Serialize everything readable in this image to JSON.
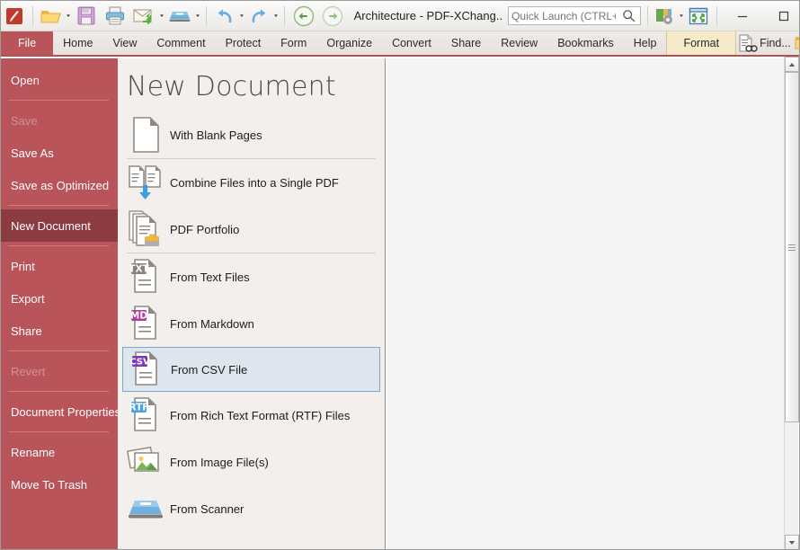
{
  "window": {
    "doc_title": "Architecture - PDF-XChang..",
    "app_icon": "pdf-xchange-logo-icon",
    "minimize_label": "—",
    "maximize_label": "□",
    "close_label": "✕"
  },
  "quick_launch": {
    "placeholder": "Quick Launch (CTRL+.)",
    "value": "",
    "search_icon": "search-icon"
  },
  "toolbar": {
    "items": [
      {
        "name": "open-file-button",
        "icon": "folder-open-icon",
        "has_dropdown": true
      },
      {
        "name": "save-button",
        "icon": "floppy-disk-icon",
        "has_dropdown": false
      },
      {
        "name": "print-button",
        "icon": "printer-icon",
        "has_dropdown": false
      },
      {
        "name": "email-button",
        "icon": "envelope-send-icon",
        "has_dropdown": true
      },
      {
        "name": "scanner-button",
        "icon": "scanner-icon",
        "has_dropdown": true
      },
      {
        "name": "undo-button",
        "icon": "undo-arrow-icon",
        "has_dropdown": true
      },
      {
        "name": "redo-button",
        "icon": "redo-arrow-icon",
        "has_dropdown": true
      },
      {
        "name": "back-button",
        "icon": "arrow-left-circle-icon",
        "has_dropdown": false
      },
      {
        "name": "forward-button",
        "icon": "arrow-right-circle-icon",
        "has_dropdown": false
      }
    ],
    "right_items": [
      {
        "name": "tools-settings-button",
        "icon": "tools-gear-icon",
        "has_dropdown": true
      },
      {
        "name": "fullscreen-button",
        "icon": "fullscreen-expand-icon",
        "has_dropdown": false
      }
    ]
  },
  "ribbon": {
    "tabs": [
      {
        "label": "File",
        "active": true,
        "style": "file"
      },
      {
        "label": "Home",
        "active": false,
        "style": "normal"
      },
      {
        "label": "View",
        "active": false,
        "style": "normal"
      },
      {
        "label": "Comment",
        "active": false,
        "style": "normal"
      },
      {
        "label": "Protect",
        "active": false,
        "style": "normal"
      },
      {
        "label": "Form",
        "active": false,
        "style": "normal"
      },
      {
        "label": "Organize",
        "active": false,
        "style": "normal"
      },
      {
        "label": "Convert",
        "active": false,
        "style": "normal"
      },
      {
        "label": "Share",
        "active": false,
        "style": "normal"
      },
      {
        "label": "Review",
        "active": false,
        "style": "normal"
      },
      {
        "label": "Bookmarks",
        "active": false,
        "style": "normal"
      },
      {
        "label": "Help",
        "active": false,
        "style": "normal"
      },
      {
        "label": "Format",
        "active": false,
        "style": "format"
      }
    ],
    "find_label": "Find...",
    "find_icon": "document-find-icon",
    "search_folder_icon": "folder-find-icon",
    "collapse_icon": "chevron-up-icon",
    "accent_color": "#b44f4f",
    "file_tab_color": "#b9545a",
    "format_tab_color": "#f6eac8"
  },
  "sidebar": {
    "background_color": "#b9545a",
    "active_color": "#8c3b40",
    "items": [
      {
        "label": "Open",
        "state": "normal",
        "name": "sidebar-item-open"
      },
      {
        "label": "SEP",
        "state": "separator",
        "name": "sidebar-separator"
      },
      {
        "label": "Save",
        "state": "disabled",
        "name": "sidebar-item-save"
      },
      {
        "label": "Save As",
        "state": "normal",
        "name": "sidebar-item-save-as"
      },
      {
        "label": "Save as Optimized",
        "state": "normal",
        "name": "sidebar-item-save-as-optimized"
      },
      {
        "label": "SEP",
        "state": "separator",
        "name": "sidebar-separator"
      },
      {
        "label": "New Document",
        "state": "active",
        "name": "sidebar-item-new-document"
      },
      {
        "label": "SEP",
        "state": "separator",
        "name": "sidebar-separator"
      },
      {
        "label": "Print",
        "state": "normal",
        "name": "sidebar-item-print"
      },
      {
        "label": "Export",
        "state": "normal",
        "name": "sidebar-item-export"
      },
      {
        "label": "Share",
        "state": "normal",
        "name": "sidebar-item-share"
      },
      {
        "label": "SEP",
        "state": "separator",
        "name": "sidebar-separator"
      },
      {
        "label": "Revert",
        "state": "disabled",
        "name": "sidebar-item-revert"
      },
      {
        "label": "SEP",
        "state": "separator",
        "name": "sidebar-separator"
      },
      {
        "label": "Document Properties",
        "state": "normal",
        "name": "sidebar-item-document-properties"
      },
      {
        "label": "SEP",
        "state": "separator",
        "name": "sidebar-separator"
      },
      {
        "label": "Rename",
        "state": "normal",
        "name": "sidebar-item-rename"
      },
      {
        "label": "Move To Trash",
        "state": "normal",
        "name": "sidebar-item-move-to-trash"
      }
    ]
  },
  "panel": {
    "title": "New Document",
    "selected_item": "From CSV File",
    "selection_fill": "#dde5ee",
    "selection_border": "#7ea6cc",
    "items": [
      {
        "label": "With Blank Pages",
        "icon": "blank-page-icon",
        "name": "new-doc-with-blank-pages",
        "selected": false,
        "sep_after": true
      },
      {
        "label": "Combine Files into a Single PDF",
        "icon": "combine-files-icon",
        "name": "new-doc-combine-files",
        "selected": false,
        "sep_after": false
      },
      {
        "label": "PDF Portfolio",
        "icon": "pdf-portfolio-icon",
        "name": "new-doc-pdf-portfolio",
        "selected": false,
        "sep_after": true
      },
      {
        "label": "From Text Files",
        "icon": "txt-file-icon",
        "badge": "TXT",
        "badge_color": "#87837e",
        "name": "new-doc-from-text-files",
        "selected": false,
        "sep_after": false
      },
      {
        "label": "From Markdown",
        "icon": "md-file-icon",
        "badge": "MD",
        "badge_color": "#b5399a",
        "name": "new-doc-from-markdown",
        "selected": false,
        "sep_after": false
      },
      {
        "label": "From CSV File",
        "icon": "csv-file-icon",
        "badge": "CSV",
        "badge_color": "#8139b5",
        "name": "new-doc-from-csv-file",
        "selected": true,
        "sep_after": false
      },
      {
        "label": "From Rich Text Format (RTF) Files",
        "icon": "rtf-file-icon",
        "badge": "RTF",
        "badge_color": "#4aa3dd",
        "name": "new-doc-from-rtf-files",
        "selected": false,
        "sep_after": false
      },
      {
        "label": "From Image File(s)",
        "icon": "image-files-icon",
        "name": "new-doc-from-image-files",
        "selected": false,
        "sep_after": false
      },
      {
        "label": "From Scanner",
        "icon": "scanner-icon",
        "name": "new-doc-from-scanner",
        "selected": false,
        "sep_after": false
      }
    ]
  },
  "scrollbar": {
    "up_arrow": "▲",
    "down_arrow": "▼",
    "thumb_position_pct": 0,
    "thumb_size_pct": 74
  }
}
